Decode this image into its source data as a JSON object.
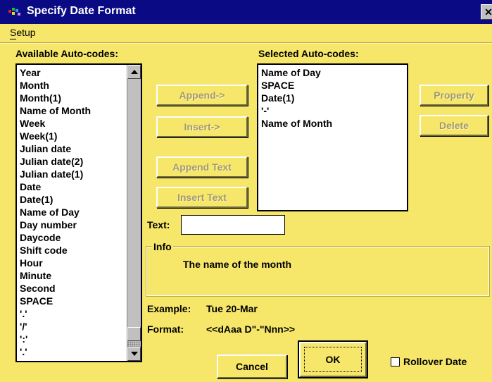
{
  "window": {
    "title": "Specify Date Format",
    "close_glyph": "✕",
    "icon": "app-multicolor-icon"
  },
  "menu": {
    "setup_label": "Setup"
  },
  "available": {
    "label": "Available Auto-codes:",
    "items": [
      "Year",
      "Month",
      "Month(1)",
      "Name of Month",
      "Week",
      "Week(1)",
      "Julian date",
      "Julian date(2)",
      "Julian date(1)",
      "Date",
      "Date(1)",
      "Name of Day",
      "Day number",
      "Daycode",
      "Shift code",
      "Hour",
      "Minute",
      "Second",
      "SPACE",
      "'.'",
      "'/'",
      "':'",
      "'.'",
      "','"
    ]
  },
  "selected": {
    "label": "Selected Auto-codes:",
    "items": [
      "Name of Day",
      "SPACE",
      "Date(1)",
      "'-'",
      "Name of Month"
    ]
  },
  "buttons": {
    "append": "Append->",
    "insert": "Insert->",
    "append_text": "Append Text",
    "insert_text": "Insert Text",
    "property": "Property",
    "delete": "Delete",
    "ok": "OK",
    "cancel": "Cancel"
  },
  "text_field": {
    "label": "Text:",
    "value": ""
  },
  "info": {
    "title": "Info",
    "message": "The name of the month"
  },
  "example": {
    "label": "Example:",
    "value": "Tue 20-Mar"
  },
  "format": {
    "label": "Format:",
    "value": "<<dAaa D\"-\"Nnn>>"
  },
  "rollover": {
    "label": "Rollover Date",
    "checked": false
  },
  "colors": {
    "background": "#f6e66a",
    "titlebar": "#0a0a84"
  }
}
